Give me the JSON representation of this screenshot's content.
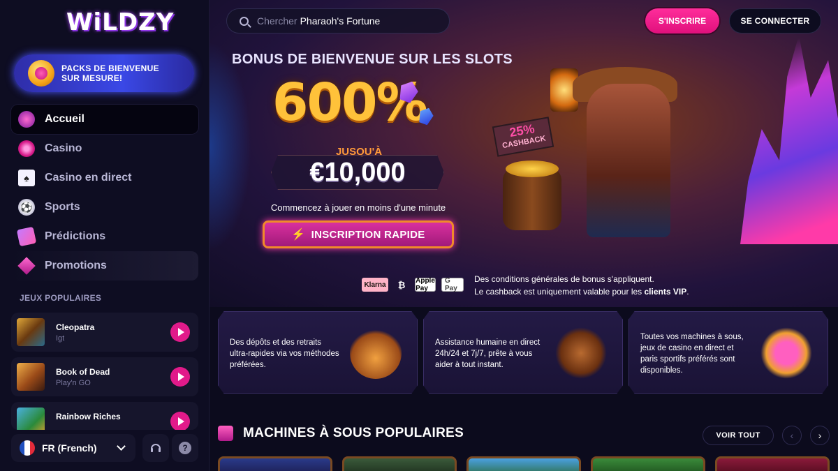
{
  "brand": {
    "logo_text": "WiLDZY"
  },
  "sidebar": {
    "promo_banner": {
      "line1": "PACKS DE BIENVENUE",
      "line2": "SUR MESURE!"
    },
    "nav": [
      {
        "label": "Accueil",
        "icon": "home-orb-icon",
        "active": true
      },
      {
        "label": "Casino",
        "icon": "casino-chip-icon"
      },
      {
        "label": "Casino en direct",
        "icon": "playing-cards-icon"
      },
      {
        "label": "Sports",
        "icon": "soccer-ball-icon"
      },
      {
        "label": "Prédictions",
        "icon": "predictions-ticket-icon"
      },
      {
        "label": "Promotions",
        "icon": "diamond-gem-icon"
      }
    ],
    "popular_title": "JEUX POPULAIRES",
    "popular_games": [
      {
        "name": "Cleopatra",
        "provider": "Igt"
      },
      {
        "name": "Book of Dead",
        "provider": "Play'n GO"
      },
      {
        "name": "Rainbow Riches",
        "provider": ""
      }
    ],
    "language": {
      "label": "FR (French)",
      "flag_colors": [
        "#1f4fbf",
        "#ffffff",
        "#e32b3a"
      ]
    },
    "support_icon": "headset-icon",
    "help_icon": "question-mark-icon"
  },
  "header": {
    "search": {
      "placeholder": "Chercher",
      "value": "Pharaoh's Fortune"
    },
    "signup_label": "S'INSCRIRE",
    "login_label": "SE CONNECTER"
  },
  "hero": {
    "title": "BONUS DE BIENVENUE SUR LES SLOTS",
    "percent": "600%",
    "upto": "JUSQU'À",
    "amount": "€10,000",
    "cashback_pct": "25%",
    "cashback_label": "CASHBACK",
    "start_text": "Commencez à jouer en moins d'une minute",
    "cta_label": "INSCRIPTION RAPIDE",
    "payments": [
      "Klarna",
      "Crypto",
      "Apple Pay",
      "G Pay"
    ],
    "terms_line1": "Des conditions générales de bonus s'appliquent.",
    "terms_line2_prefix": "Le cashback est uniquement valable pour les ",
    "terms_line2_bold": "clients VIP",
    "terms_line2_suffix": "."
  },
  "features": [
    {
      "text": "Des dépôts et des retraits ultra-rapides via vos méthodes préférées.",
      "art": "gold-sack-icon"
    },
    {
      "text": "Assistance humaine en direct 24h/24 et 7j/7, prête à vous aider à tout instant.",
      "art": "miner-hat-icon"
    },
    {
      "text": "Toutes vos machines à sous, jeux de casino en direct et paris sportifs préférés sont disponibles.",
      "art": "club-suit-icon"
    }
  ],
  "slots_section": {
    "title": "MACHINES À SOUS POPULAIRES",
    "view_all": "VOIR TOUT",
    "prev_icon": "chevron-left-icon",
    "next_icon": "chevron-right-icon"
  },
  "colors": {
    "accent_pink": "#e11a8a",
    "gold": "#ffc23a",
    "bg": "#0c0b1d"
  }
}
